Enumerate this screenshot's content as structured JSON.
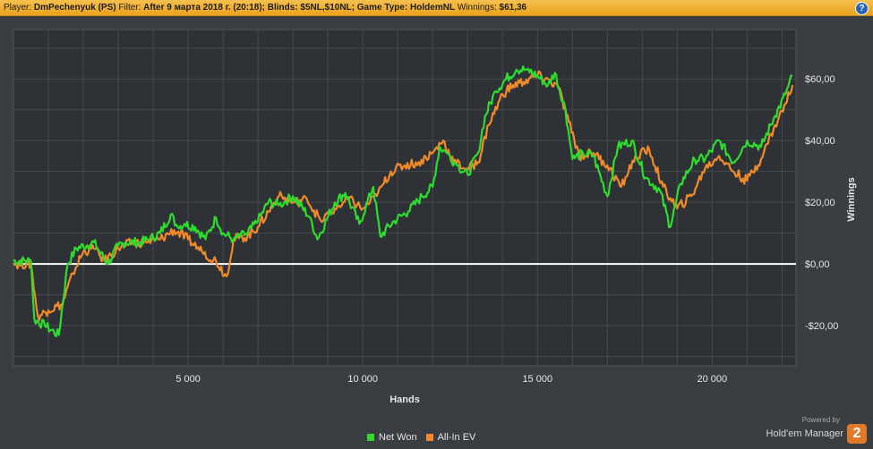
{
  "header": {
    "player_label": "Player:",
    "player_value": "DmPechenyuk (PS)",
    "filter_label": "Filter:",
    "filter_value": "After 9 марта 2018 г. (20:18); Blinds: $5NL,$10NL; Game Type: HoldemNL",
    "winnings_label": "Winnings:",
    "winnings_value": "$61,36",
    "help_glyph": "?"
  },
  "branding": {
    "powered_by": "Powered by",
    "product": "Hold'em Manager",
    "version_badge": "2"
  },
  "chart_data": {
    "type": "line",
    "xlabel": "Hands",
    "ylabel": "Winnings",
    "xlim": [
      0,
      22400
    ],
    "ylim": [
      -33,
      76
    ],
    "x_ticks": [
      5000,
      10000,
      15000,
      20000
    ],
    "x_tick_labels": [
      "5 000",
      "10 000",
      "15 000",
      "20 000"
    ],
    "y_ticks": [
      -20,
      0,
      20,
      40,
      60
    ],
    "y_tick_labels": [
      "-$20,00",
      "$0,00",
      "$20,00",
      "$40,00",
      "$60,00"
    ],
    "zero_line": true,
    "legend_position": "bottom-center",
    "series": [
      {
        "name": "Net Won",
        "color": "#2edc2e",
        "x": [
          0,
          500,
          600,
          900,
          1300,
          1550,
          1800,
          2300,
          2700,
          3000,
          3200,
          3600,
          3900,
          4200,
          4500,
          4700,
          4900,
          5200,
          5500,
          5800,
          6000,
          6300,
          6700,
          7000,
          7300,
          7600,
          8000,
          8500,
          8700,
          9200,
          9500,
          9900,
          10300,
          10500,
          10900,
          11300,
          11700,
          12000,
          12200,
          12400,
          12700,
          13000,
          13300,
          13500,
          13800,
          14100,
          14400,
          14700,
          15000,
          15300,
          15500,
          15800,
          16000,
          16300,
          16600,
          17000,
          17300,
          17700,
          18100,
          18500,
          18800,
          19100,
          19500,
          19800,
          20200,
          20600,
          21000,
          21400,
          21800,
          22100,
          22300
        ],
        "y": [
          1,
          1,
          -18,
          -20,
          -23,
          0,
          5,
          7,
          0,
          6,
          7,
          7,
          8,
          10,
          16,
          12,
          13,
          12,
          8,
          15,
          10,
          8,
          10,
          14,
          20,
          19,
          22,
          15,
          8,
          20,
          23,
          13,
          25,
          9,
          14,
          17,
          22,
          25,
          38,
          36,
          32,
          29,
          36,
          48,
          56,
          60,
          63,
          63,
          61,
          58,
          62,
          50,
          34,
          36,
          35,
          22,
          38,
          40,
          28,
          24,
          12,
          26,
          34,
          34,
          40,
          33,
          40,
          38,
          48,
          55,
          61
        ]
      },
      {
        "name": "All-In EV",
        "color": "#f08a2a",
        "x": [
          0,
          500,
          700,
          1000,
          1400,
          1700,
          2000,
          2300,
          2600,
          3000,
          3400,
          3800,
          4200,
          4600,
          5000,
          5400,
          5800,
          6100,
          6300,
          6700,
          7000,
          7300,
          7600,
          8000,
          8400,
          8800,
          9200,
          9600,
          10000,
          10400,
          10800,
          11200,
          11600,
          12000,
          12300,
          12600,
          13000,
          13300,
          13600,
          14000,
          14300,
          14600,
          15000,
          15300,
          15600,
          15900,
          16200,
          16600,
          17000,
          17400,
          17800,
          18200,
          18600,
          19000,
          19400,
          19800,
          20200,
          20600,
          21000,
          21400,
          21800,
          22100,
          22300
        ],
        "y": [
          0,
          0,
          -17,
          -15,
          -13,
          -3,
          4,
          5,
          1,
          5,
          7,
          7,
          8,
          11,
          8,
          4,
          1,
          -4,
          8,
          9,
          12,
          17,
          22,
          20,
          21,
          14,
          18,
          21,
          18,
          22,
          30,
          32,
          33,
          36,
          40,
          33,
          31,
          33,
          45,
          55,
          58,
          59,
          61,
          60,
          57,
          46,
          35,
          36,
          32,
          25,
          35,
          37,
          25,
          18,
          22,
          31,
          35,
          30,
          27,
          34,
          45,
          52,
          58
        ]
      }
    ]
  }
}
